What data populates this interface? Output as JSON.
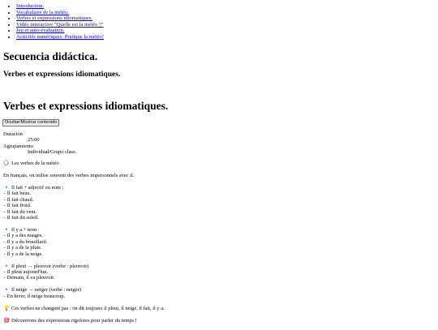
{
  "nav": [
    "Introduction.",
    "Vocabulaire de la météo.",
    "Verbes et expressions idiomatiques.",
    "Vidéo interactive \"Quelle est la météo ?\"",
    "Jeu et auto-évaluation.",
    "Activités numériques: Pratique la météo!"
  ],
  "title": "Secuencia didáctica.",
  "subtitle": "Verbes et expressions idiomatiques.",
  "section_title": "Verbes et expressions idiomatiques.",
  "toggle_label": "Ocultar/Mostrar contenido",
  "meta": {
    "duration_label": "Duración",
    "duration_value": "25:00",
    "grouping_label": "Agrupamiento",
    "grouping_value": "Individual/Grupo clase."
  },
  "content": {
    "heading_icon": "speech-head-icon",
    "heading": "Les verbes de la météo",
    "intro": "En français, on utilise souvent des verbes impersonnels avec il.",
    "blocks": [
      {
        "icon": "small-blue-diamond-icon",
        "lines": [
          "Il fait + adjectif ou nom :",
          "– Il fait beau.",
          "– Il fait chaud.",
          "– Il fait froid.",
          "– Il fait du vent.",
          "– Il fait du soleil."
        ]
      },
      {
        "icon": "small-blue-diamond-icon",
        "lines": [
          "Il y a + nom :",
          "– Il y a des nuages.",
          "– Il y a du brouillard.",
          "– Il y a de la pluie.",
          "– Il y a de la neige."
        ]
      },
      {
        "icon": "small-blue-diamond-icon",
        "lines": [
          "Il pleut → pleuvoir (verbe : pleuvoir)",
          "– Il pleut aujourd'hui.",
          "– Demain, il va pleuvoir."
        ]
      },
      {
        "icon": "small-blue-diamond-icon",
        "lines": [
          "Il neige → neiger (verbe : neiger)",
          "– En hiver, il neige beaucoup."
        ]
      }
    ],
    "tip_icon": "light-bulb-icon",
    "tip": "Ces verbes ne changent pas : on dit toujours il pleut, il neige, il fait, il y a.",
    "target_icon": "target-icon",
    "closing": "Découvrons des expressions rigolotes pour parler du temps !"
  }
}
